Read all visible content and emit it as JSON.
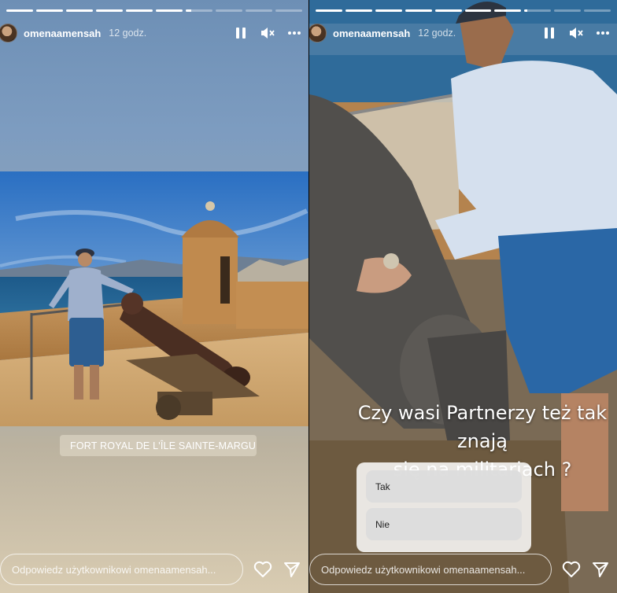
{
  "stories": [
    {
      "username": "omenaamensah",
      "time": "12 godz.",
      "progress": [
        1,
        1,
        1,
        1,
        1,
        1,
        0.2,
        0,
        0,
        0
      ],
      "location": "FORT ROYAL DE L'ÎLE SAINTE-MARGUERI...",
      "reply_placeholder": "Odpowiedz użytkownikowi omenaamensah..."
    },
    {
      "username": "omenaamensah",
      "time": "12 godz.",
      "progress": [
        1,
        1,
        1,
        1,
        1,
        1,
        1,
        0.1,
        0,
        0
      ],
      "question_line1": "Czy wasi Partnerzy też tak znają",
      "question_line2": "się na militariach ?",
      "poll_options": [
        "Tak",
        "Nie"
      ],
      "reply_placeholder": "Odpowiedz użytkownikowi omenaamensah..."
    }
  ],
  "icons": {
    "pause": "pause-icon",
    "mute": "mute-icon",
    "more": "more-icon",
    "like": "heart-icon",
    "share": "send-icon",
    "location": "location-pin-icon"
  }
}
